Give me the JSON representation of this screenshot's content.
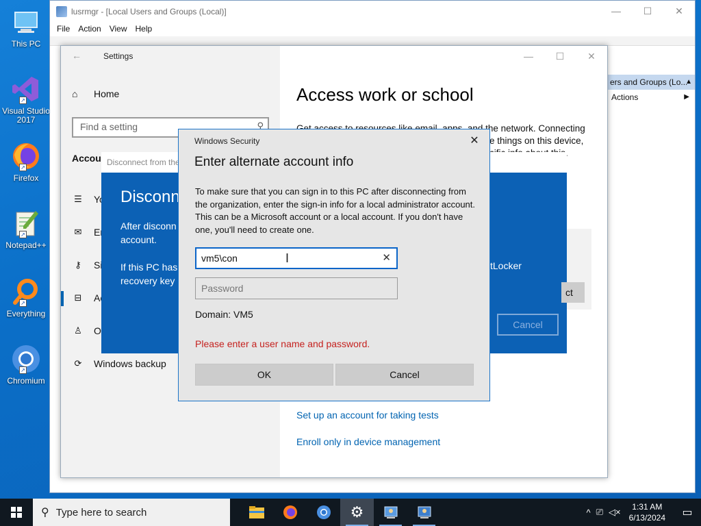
{
  "desktop": {
    "icons": [
      {
        "label": "This PC",
        "icon": "this-pc-icon"
      },
      {
        "label": "Visual Studio 2017",
        "icon": "visual-studio-icon"
      },
      {
        "label": "Firefox",
        "icon": "firefox-icon"
      },
      {
        "label": "Notepad++",
        "icon": "notepadpp-icon"
      },
      {
        "label": "Everything",
        "icon": "everything-icon"
      },
      {
        "label": "Chromium",
        "icon": "chromium-icon"
      }
    ]
  },
  "lusrmgr": {
    "title": "lusrmgr - [Local Users and Groups (Local)]",
    "menu": [
      "File",
      "Action",
      "View",
      "Help"
    ],
    "actions_header": "ers and Groups (Lo...",
    "actions_item": "Actions"
  },
  "settings": {
    "title": "Settings",
    "home": "Home",
    "search_placeholder": "Find a setting",
    "section": "Accou",
    "nav": [
      {
        "label": "Yo",
        "icon": "your-info-icon"
      },
      {
        "label": "Em",
        "icon": "email-icon"
      },
      {
        "label": "Si",
        "icon": "sign-in-key-icon"
      },
      {
        "label": "Ac",
        "icon": "briefcase-icon"
      },
      {
        "label": "Ot",
        "icon": "other-users-icon"
      },
      {
        "label": "Windows backup",
        "icon": "sync-icon"
      }
    ],
    "page_title": "Access work or school",
    "page_body_1": "Get access to resources like email, apps, and the network. Connecting",
    "page_body_2": "e things on this device,",
    "page_body_3": "cific info about this.",
    "links": [
      "Set up an account for taking tests",
      "Enroll only in device management"
    ]
  },
  "disconnect": {
    "titlebar": "Disconnect from the",
    "heading": "Disconn",
    "para1_a": "After disconn",
    "para1_b": "account.",
    "para2_a": "If this PC has",
    "para2_b": "recovery key",
    "right1": "'s",
    "right2": "tLocker",
    "gray_button": "ct",
    "cancel": "Cancel"
  },
  "winsec": {
    "window_title": "Windows Security",
    "heading": "Enter alternate account info",
    "description": "To make sure that you can sign in to this PC after disconnecting from the organization, enter the sign-in info for a local administrator account. This can be a Microsoft account or a local account. If you don't have one, you'll need to create one.",
    "username_value": "vm5\\con",
    "password_placeholder": "Password",
    "domain": "Domain: VM5",
    "error": "Please enter a user name and password.",
    "ok": "OK",
    "cancel": "Cancel"
  },
  "taskbar": {
    "search_placeholder": "Type here to search",
    "time": "1:31 AM",
    "date": "6/13/2024",
    "apps": [
      "file-explorer-icon",
      "firefox-icon",
      "chromium-icon",
      "settings-gear-icon",
      "lusrmgr-icon",
      "computer-management-icon"
    ]
  }
}
